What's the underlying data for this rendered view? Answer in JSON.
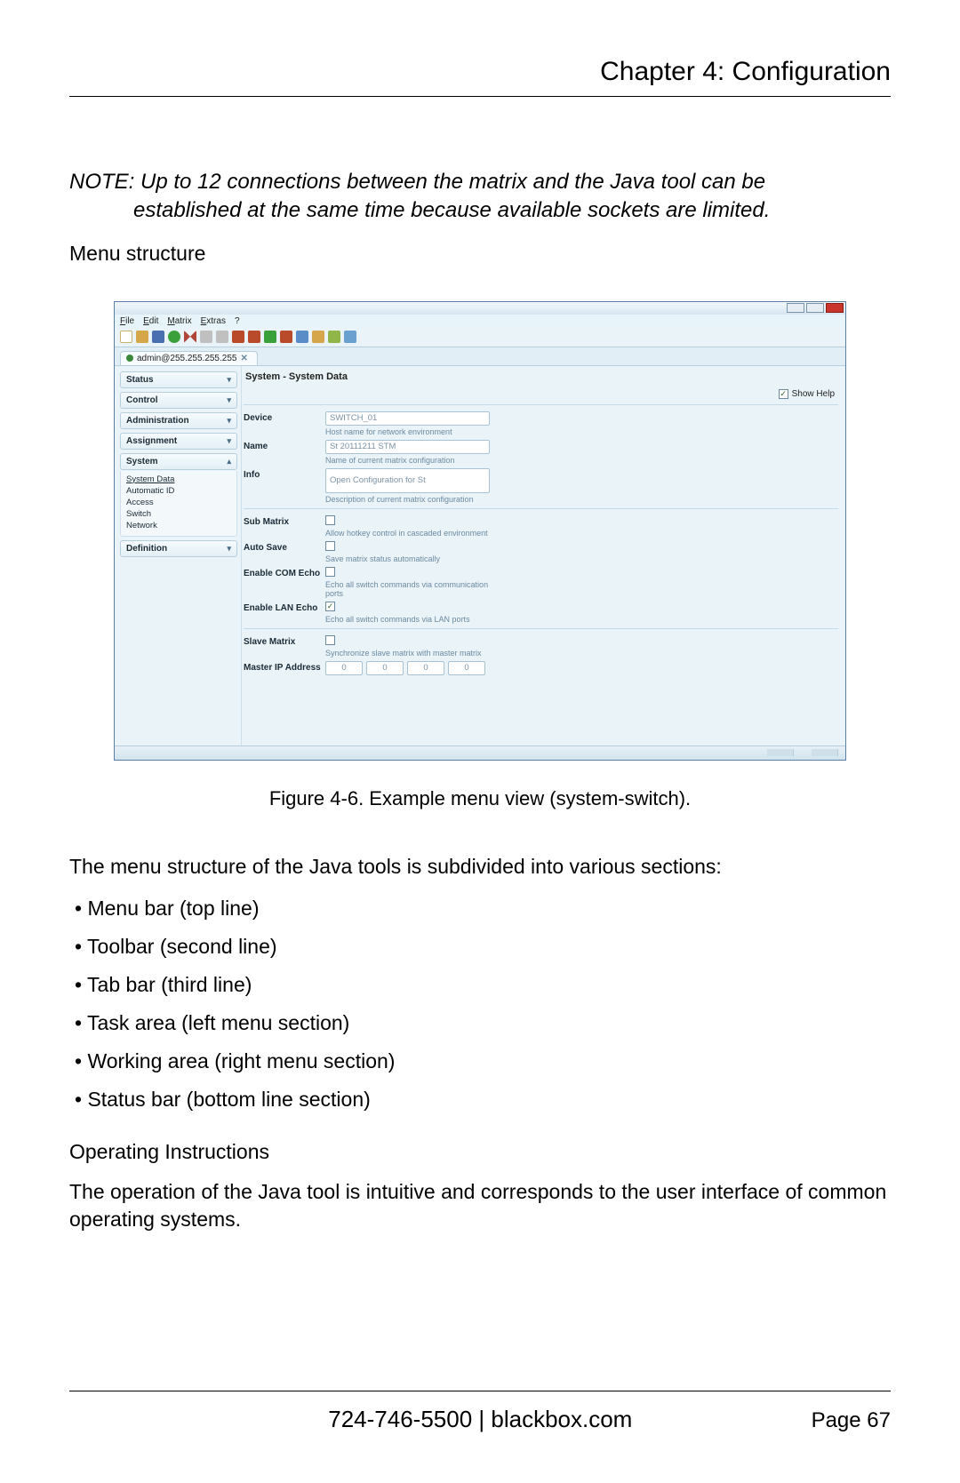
{
  "header": {
    "chapter_title": "Chapter 4: Configuration"
  },
  "note": {
    "line1": "NOTE: Up to 12 connections between the matrix and the Java tool can be",
    "line2": "established at the same time because available sockets are limited."
  },
  "menu_structure_label": "Menu structure",
  "screenshot": {
    "menubar": {
      "file": "File",
      "edit": "Edit",
      "matrix": "Matrix",
      "extras": "Extras",
      "help": "?"
    },
    "tab": {
      "label": "admin@255.255.255.255",
      "close": "✕"
    },
    "sidebar": {
      "status": "Status",
      "control": "Control",
      "administration": "Administration",
      "assignment": "Assignment",
      "system": "System",
      "system_sub": {
        "system_data": "System Data",
        "automatic_id": "Automatic ID",
        "access": "Access",
        "switch": "Switch",
        "network": "Network"
      },
      "definition": "Definition"
    },
    "work": {
      "title": "System - System Data",
      "show_help": "Show Help",
      "fields": {
        "device": {
          "label": "Device",
          "value": "SWITCH_01",
          "hint": "Host name for network environment"
        },
        "name": {
          "label": "Name",
          "value": "St 20111211 STM",
          "hint": "Name of current matrix configuration"
        },
        "info": {
          "label": "Info",
          "value": "Open Configuration for St",
          "hint": "Description of current matrix configuration"
        },
        "sub_matrix": {
          "label": "Sub Matrix",
          "hint": "Allow hotkey control in cascaded environment"
        },
        "auto_save": {
          "label": "Auto Save",
          "hint": "Save matrix status automatically"
        },
        "enable_com": {
          "label": "Enable COM Echo",
          "hint": "Echo all switch commands via communication ports"
        },
        "enable_lan": {
          "label": "Enable LAN Echo",
          "hint": "Echo all switch commands via LAN ports"
        },
        "slave_matrix": {
          "label": "Slave Matrix",
          "hint": "Synchronize slave matrix with master matrix"
        },
        "master_ip": {
          "label": "Master IP Address",
          "octet": "0"
        }
      }
    }
  },
  "figure_caption": "Figure 4-6. Example menu view (system-switch).",
  "intro_para": "The menu structure of the Java tools is subdivided into various sections:",
  "bullets": {
    "b1": "Menu bar (top line)",
    "b2": "Toolbar (second line)",
    "b3": "Tab bar (third line)",
    "b4": "Task area (left menu section)",
    "b5": "Working area (right menu section)",
    "b6": "Status bar (bottom line section)"
  },
  "op_heading": "Operating Instructions",
  "op_para": "The operation of the Java tool is intuitive and corresponds to the user interface of common operating systems.",
  "footer": {
    "phone_site": "724-746-5500   |   blackbox.com",
    "page": "Page 67"
  }
}
